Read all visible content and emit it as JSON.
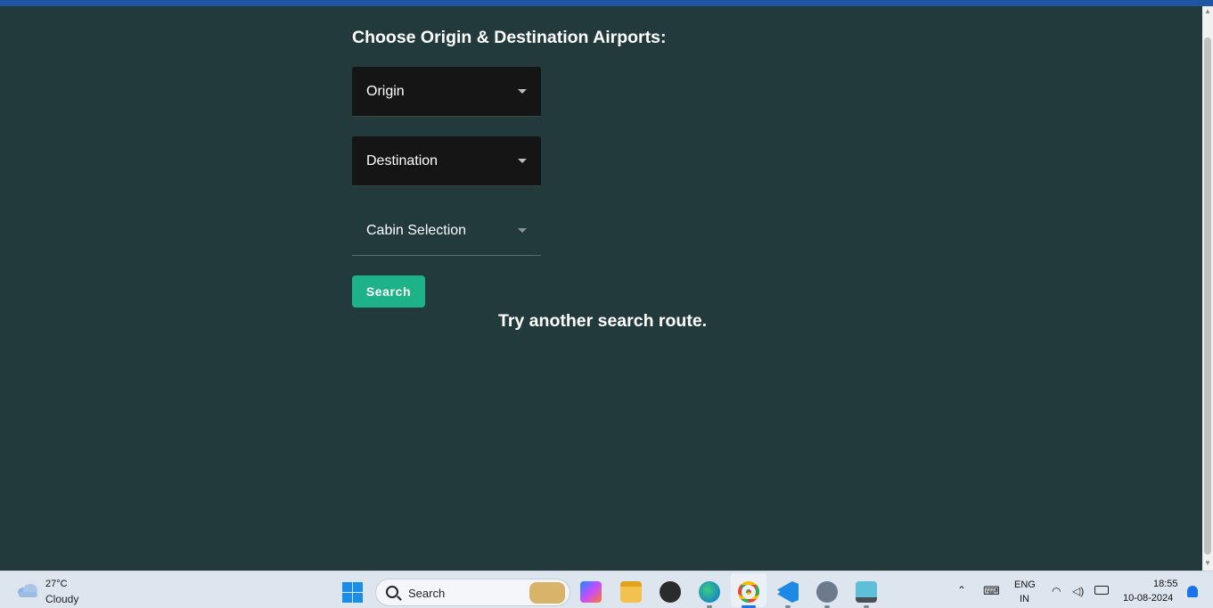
{
  "page": {
    "heading": "Choose Origin & Destination Airports:",
    "origin_label": "Origin",
    "destination_label": "Destination",
    "cabin_label": "Cabin Selection",
    "cabin_required_mark": "*",
    "search_button": "Search",
    "message": "Try another search route."
  },
  "colors": {
    "background": "#223a3c",
    "select_background": "#151515",
    "button": "#1db386",
    "topbar": "#1d56a3"
  },
  "taskbar": {
    "weather_temp": "27°C",
    "weather_desc": "Cloudy",
    "search_placeholder": "Search",
    "lang_line1": "ENG",
    "lang_line2": "IN",
    "time": "18:55",
    "date": "10-08-2024",
    "apps": [
      "copilot-icon",
      "file-explorer-icon",
      "obs-icon",
      "edge-icon",
      "chrome-icon",
      "vscode-icon",
      "settings-icon",
      "remote-desktop-icon"
    ]
  }
}
